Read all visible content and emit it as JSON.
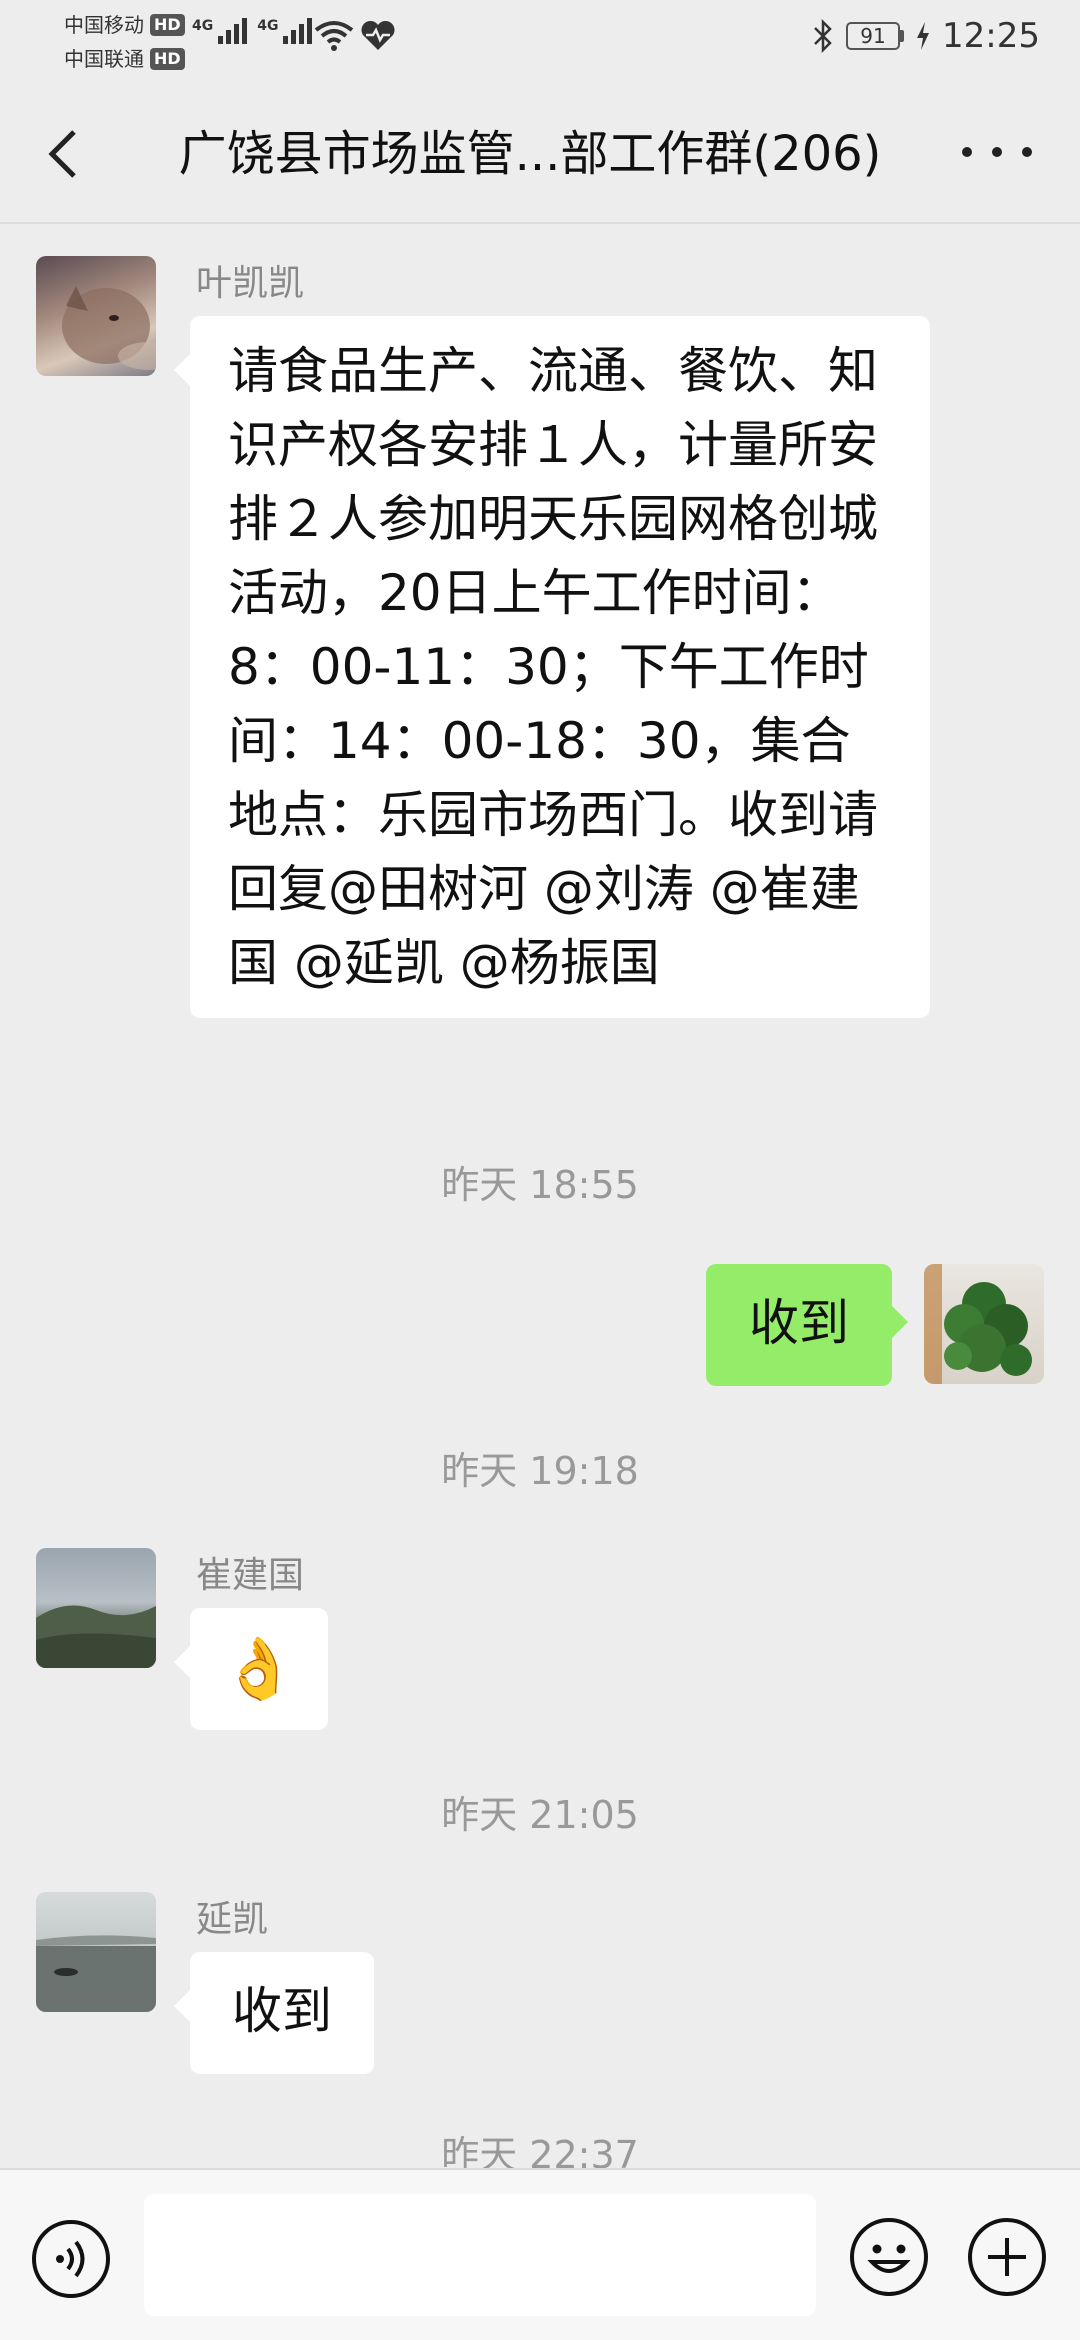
{
  "status_bar": {
    "carrier1": "中国移动",
    "carrier2": "中国联通",
    "hd": "HD",
    "network1": "4G",
    "network2": "4G",
    "battery": "91",
    "time": "12:25"
  },
  "header": {
    "title": "广饶县市场监管...部工作群(206)"
  },
  "messages": [
    {
      "sender": "叶凯凯",
      "text": "请食品生产、流通、餐饮、知识产权各安排１人，计量所安排２人参加明天乐园网格创城活动，20日上午工作时间：8：00-11：30；下午工作时间：14：00-18：30，集合地点：乐园市场西门。收到请回复@田树河 @刘涛 @崔建国 @延凯 @杨振国"
    },
    {
      "timestamp": "昨天 18:55"
    },
    {
      "text": "收到",
      "self": true
    },
    {
      "timestamp": "昨天 19:18"
    },
    {
      "sender": "崔建国",
      "emoji": "👌"
    },
    {
      "timestamp": "昨天 21:05"
    },
    {
      "sender": "延凯",
      "text": "收到"
    },
    {
      "timestamp": "昨天 22:37"
    }
  ],
  "input": {
    "placeholder": ""
  }
}
